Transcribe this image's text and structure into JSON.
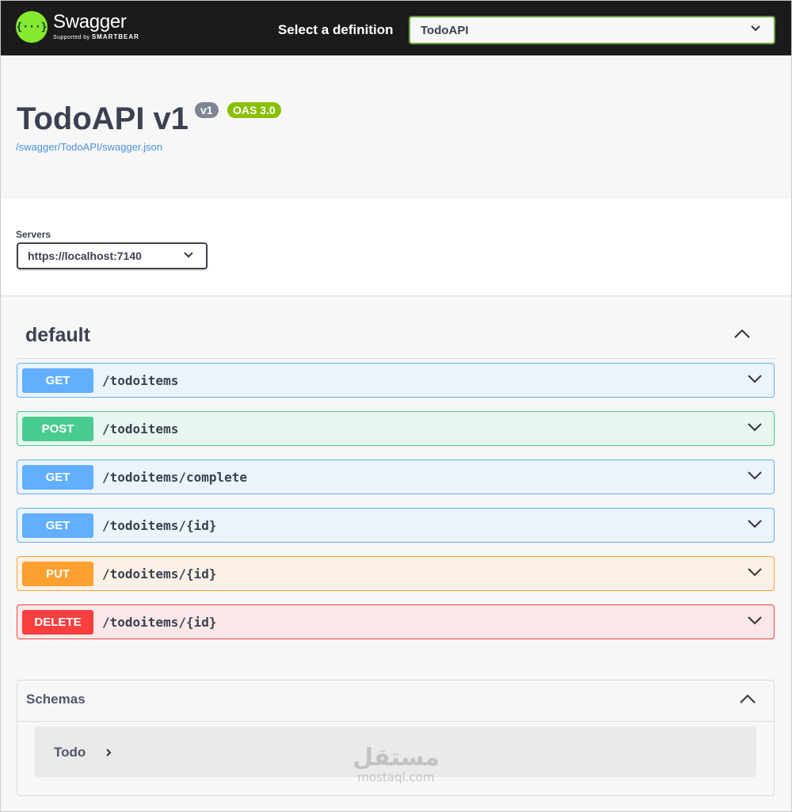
{
  "header": {
    "logo_name": "Swagger",
    "logo_sub_prefix": "Supported by",
    "logo_sub_brand": "SMARTBEAR",
    "definition_label": "Select a definition",
    "definition_value": "TodoAPI"
  },
  "info": {
    "title": "TodoAPI v1",
    "version_badge": "v1",
    "oas_badge": "OAS 3.0",
    "spec_url": "/swagger/TodoAPI/swagger.json"
  },
  "servers": {
    "label": "Servers",
    "selected": "https://localhost:7140"
  },
  "tag": {
    "name": "default"
  },
  "operations": [
    {
      "method": "GET",
      "path": "/todoitems"
    },
    {
      "method": "POST",
      "path": "/todoitems"
    },
    {
      "method": "GET",
      "path": "/todoitems/complete"
    },
    {
      "method": "GET",
      "path": "/todoitems/{id}"
    },
    {
      "method": "PUT",
      "path": "/todoitems/{id}"
    },
    {
      "method": "DELETE",
      "path": "/todoitems/{id}"
    }
  ],
  "schemas": {
    "title": "Schemas",
    "models": [
      {
        "name": "Todo"
      }
    ]
  },
  "watermark": {
    "arabic": "مستقل",
    "latin": "mostaql.com"
  },
  "colors": {
    "topbar": "#1b1b1b",
    "logo_green": "#85ea2d",
    "get": "#61affe",
    "post": "#49cc90",
    "put": "#fca130",
    "delete": "#f93e3e",
    "link": "#4990e2"
  }
}
